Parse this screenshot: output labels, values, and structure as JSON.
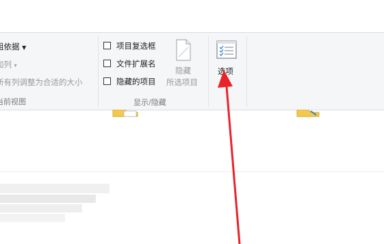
{
  "ribbon": {
    "layout_group": {
      "group_by_label": "组依据",
      "add_columns_label": "加列",
      "size_all_columns_label": "所有列调整为合适的大小",
      "group_label": "当前视图"
    },
    "show_hide_group": {
      "checkbox_items": [
        {
          "label": "项目复选框",
          "checked": false
        },
        {
          "label": "文件扩展名",
          "checked": false
        },
        {
          "label": "隐藏的项目",
          "checked": false
        }
      ],
      "hide_selected": {
        "line1": "隐藏",
        "line2": "所选项目"
      },
      "group_label": "显示/隐藏"
    },
    "options_button": {
      "label": "选项"
    }
  },
  "colors": {
    "ribbon_bg": "#f5f6f7",
    "arrow": "#e8232a",
    "folder": "#f2c94c"
  }
}
